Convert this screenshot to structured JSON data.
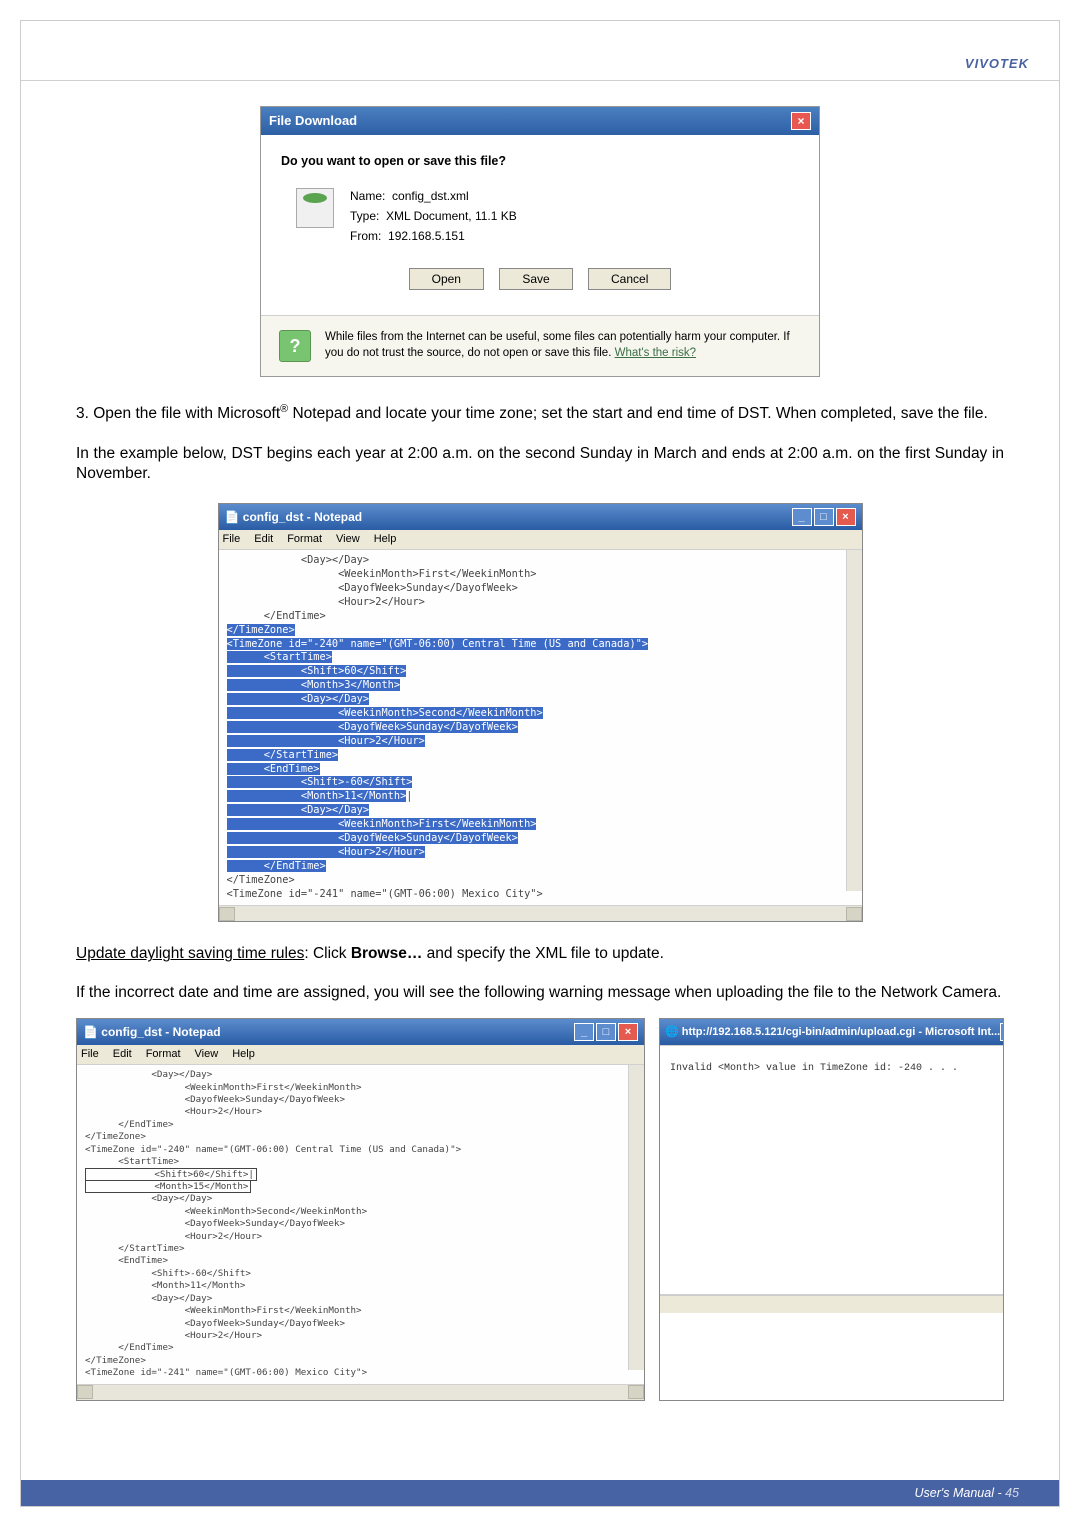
{
  "header": {
    "brand": "VIVOTEK"
  },
  "file_download": {
    "title": "File Download",
    "prompt": "Do you want to open or save this file?",
    "name_label": "Name:",
    "name_value": "config_dst.xml",
    "type_label": "Type:",
    "type_value": "XML Document, 11.1 KB",
    "from_label": "From:",
    "from_value": "192.168.5.151",
    "open_btn": "Open",
    "save_btn": "Save",
    "cancel_btn": "Cancel",
    "warning_text": "While files from the Internet can be useful, some files can potentially harm your computer. If you do not trust the source, do not open or save this file. ",
    "warning_link": "What's the risk?"
  },
  "step3": {
    "prefix": "3. Open the file with Microsoft",
    "reg": "®",
    "suffix1": " Notepad and locate your time zone; set the start and end time of DST. When completed, save the file.",
    "example": "In the example below, DST begins each year at 2:00 a.m. on the second Sunday in March and ends at 2:00 a.m. on the first Sunday in November."
  },
  "notepad1": {
    "title": "config_dst - Notepad",
    "menu": [
      "File",
      "Edit",
      "Format",
      "View",
      "Help"
    ],
    "xml_top": "            <Day></Day>\n                  <WeekinMonth>First</WeekinMonth>\n                  <DayofWeek>Sunday</DayofWeek>\n                  <Hour>2</Hour>\n      </EndTime>",
    "xml_sel_open": "</TimeZone>\n<TimeZone id=\"-240\" name=\"(GMT-06:00) Central Time (US and Canada)\">\n      <StartTime>\n            <Shift>60</Shift>\n            <Month>3</Month>\n            <Day></Day>\n                  <WeekinMonth>Second</WeekinMonth>\n                  <DayofWeek>Sunday</DayofWeek>\n                  <Hour>2</Hour>\n      </StartTime>\n      <EndTime>\n            <Shift>-60</Shift>\n            <Month>11</Month>",
    "xml_sel_mid": "|",
    "xml_sel_rest": "            <Day></Day>\n                  <WeekinMonth>First</WeekinMonth>\n                  <DayofWeek>Sunday</DayofWeek>\n                  <Hour>2</Hour>\n      </EndTime>",
    "xml_bottom": "</TimeZone>\n<TimeZone id=\"-241\" name=\"(GMT-06:00) Mexico City\">"
  },
  "update_heading": "Update daylight saving time rules",
  "update_text": ": Click ",
  "update_button_label": "Browse…",
  "update_text2": " and specify the XML file to update.",
  "incorrect_para": "If the incorrect date and time are assigned, you will see the following warning message when uploading the file to the Network Camera.",
  "notepad2": {
    "title": "config_dst - Notepad",
    "menu": [
      "File",
      "Edit",
      "Format",
      "View",
      "Help"
    ],
    "xml_top": "            <Day></Day>\n                  <WeekinMonth>First</WeekinMonth>\n                  <DayofWeek>Sunday</DayofWeek>\n                  <Hour>2</Hour>\n      </EndTime>\n</TimeZone>\n<TimeZone id=\"-240\" name=\"(GMT-06:00) Central Time (US and Canada)\">\n      <StartTime>",
    "xml_boxed1": "            <Shift>60</Shift>|",
    "xml_boxed2": "            <Month>15</Month>",
    "xml_rest": "            <Day></Day>\n                  <WeekinMonth>Second</WeekinMonth>\n                  <DayofWeek>Sunday</DayofWeek>\n                  <Hour>2</Hour>\n      </StartTime>\n      <EndTime>\n            <Shift>-60</Shift>\n            <Month>11</Month>\n            <Day></Day>\n                  <WeekinMonth>First</WeekinMonth>\n                  <DayofWeek>Sunday</DayofWeek>\n                  <Hour>2</Hour>\n      </EndTime>\n</TimeZone>\n<TimeZone id=\"-241\" name=\"(GMT-06:00) Mexico City\">"
  },
  "ie": {
    "title": "http://192.168.5.121/cgi-bin/admin/upload.cgi - Microsoft Int...",
    "body": "Invalid <Month> value in TimeZone id: -240 . . ."
  },
  "footer": {
    "label": "User's Manual - ",
    "page": "45"
  }
}
